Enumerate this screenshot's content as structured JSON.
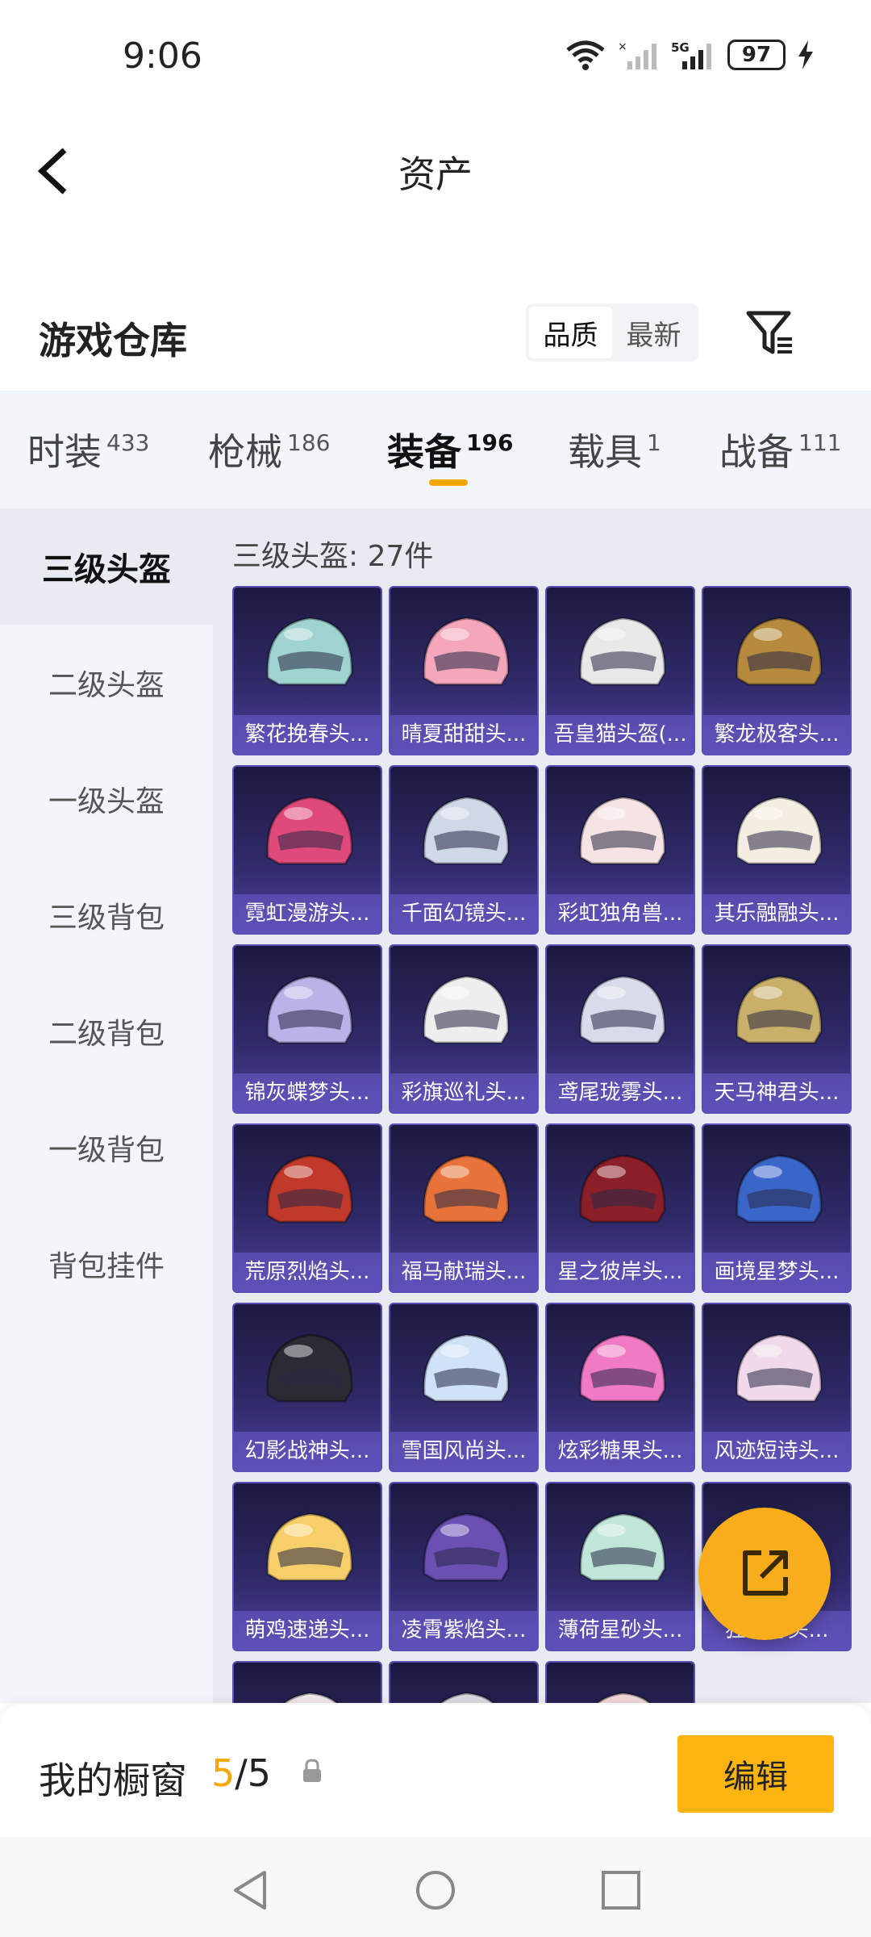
{
  "status_bar": {
    "time": "9:06",
    "battery": "97"
  },
  "header": {
    "title": "资产"
  },
  "warehouse": {
    "title": "游戏仓库",
    "sort_options": [
      "品质",
      "最新"
    ],
    "sort_active": 0
  },
  "tabs": [
    {
      "label": "时装",
      "count": "433"
    },
    {
      "label": "枪械",
      "count": "186"
    },
    {
      "label": "装备",
      "count": "196"
    },
    {
      "label": "载具",
      "count": "1"
    },
    {
      "label": "战备",
      "count": "111"
    }
  ],
  "active_tab": 2,
  "subnav": [
    {
      "label": "三级头盔"
    },
    {
      "label": "二级头盔"
    },
    {
      "label": "一级头盔"
    },
    {
      "label": "三级背包"
    },
    {
      "label": "二级背包"
    },
    {
      "label": "一级背包"
    },
    {
      "label": "背包挂件"
    }
  ],
  "active_subnav": 0,
  "content": {
    "count_label": "三级头盔: 27件"
  },
  "items": [
    {
      "name": "繁花挽春头...",
      "color": "#9fd3cf"
    },
    {
      "name": "晴夏甜甜头...",
      "color": "#f4a7bb"
    },
    {
      "name": "吾皇猫头盔(...",
      "color": "#e8e8e8"
    },
    {
      "name": "繁龙极客头...",
      "color": "#b58a3c"
    },
    {
      "name": "霓虹漫游头...",
      "color": "#e04a7a"
    },
    {
      "name": "千面幻镜头...",
      "color": "#cfd8e6"
    },
    {
      "name": "彩虹独角兽...",
      "color": "#f6e3e3"
    },
    {
      "name": "其乐融融头...",
      "color": "#f4eee2"
    },
    {
      "name": "锦灰蝶梦头...",
      "color": "#b9b3e8"
    },
    {
      "name": "彩旗巡礼头...",
      "color": "#eeeeee"
    },
    {
      "name": "鸢尾珑雾头...",
      "color": "#d7dbea"
    },
    {
      "name": "天马神君头...",
      "color": "#c9b06a"
    },
    {
      "name": "荒原烈焰头...",
      "color": "#c0392b"
    },
    {
      "name": "福马献瑞头...",
      "color": "#e8733a"
    },
    {
      "name": "星之彼岸头...",
      "color": "#8a1f2a"
    },
    {
      "name": "画境星梦头...",
      "color": "#3a66c9"
    },
    {
      "name": "幻影战神头...",
      "color": "#2b2b33"
    },
    {
      "name": "雪国风尚头...",
      "color": "#cfe2f6"
    },
    {
      "name": "炫彩糖果头...",
      "color": "#f07bc4"
    },
    {
      "name": "风迹短诗头...",
      "color": "#efd9ea"
    },
    {
      "name": "萌鸡速递头...",
      "color": "#f6cf6a"
    },
    {
      "name": "凌霄紫焰头...",
      "color": "#6b4fb3"
    },
    {
      "name": "薄荷星砂头...",
      "color": "#bfe6d8"
    },
    {
      "name": "狂…狩头...",
      "color": "#c9c9d6"
    },
    {
      "name": "",
      "color": "#efe6e6"
    },
    {
      "name": "",
      "color": "#d8d8de"
    },
    {
      "name": "",
      "color": "#f0d6d6"
    }
  ],
  "showcase": {
    "label": "我的橱窗",
    "current": "5",
    "total": "/5",
    "edit": "编辑"
  }
}
